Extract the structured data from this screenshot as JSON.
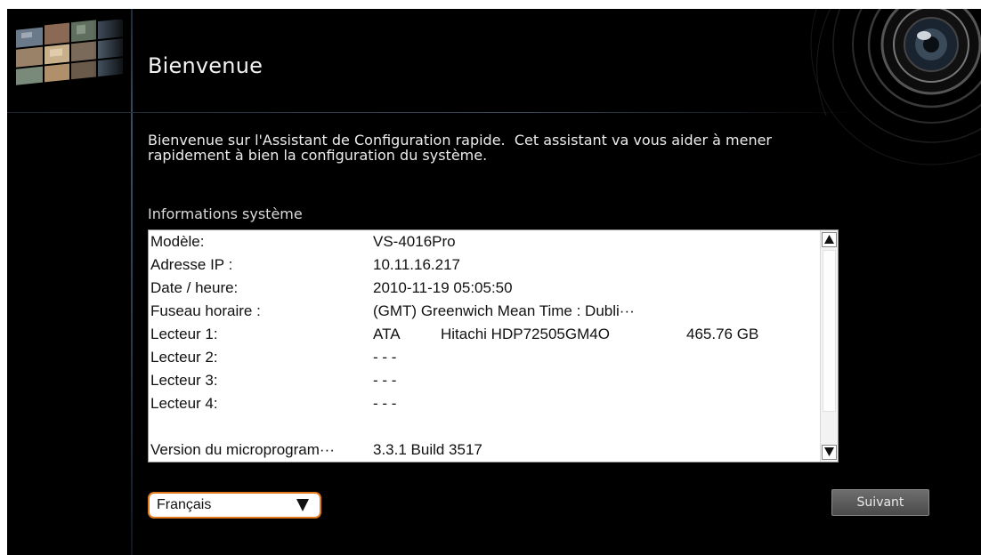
{
  "header": {
    "title": "Bienvenue"
  },
  "welcome": {
    "line1": "Bienvenue sur l'Assistant de Configuration rapide.  Cet assistant va vous aider à mener",
    "line2": "rapidement à bien la configuration du système."
  },
  "system_info": {
    "heading": "Informations système",
    "rows": [
      {
        "label": "Modèle:",
        "value": "VS-4016Pro"
      },
      {
        "label": "Adresse IP :",
        "value": "10.11.16.217"
      },
      {
        "label": "Date / heure:",
        "value": "2010-11-19 05:05:50"
      },
      {
        "label": "Fuseau horaire :",
        "value": "(GMT) Greenwich Mean Time : Dubli···"
      },
      {
        "label": "Lecteur 1:",
        "value": "ATA",
        "model": "Hitachi HDP72505GM4O",
        "size": "465.76 GB"
      },
      {
        "label": "Lecteur 2:",
        "value": "- - -"
      },
      {
        "label": "Lecteur 3:",
        "value": "- - -"
      },
      {
        "label": "Lecteur 4:",
        "value": "- - -"
      },
      {
        "label": "Version du microprogram···",
        "value": "3.3.1 Build 3517"
      }
    ]
  },
  "language": {
    "selected": "Français"
  },
  "footer": {
    "next_label": "Suivant"
  },
  "icons": {
    "scroll_up": "triangle-up-icon",
    "scroll_down": "triangle-down-icon",
    "dropdown": "triangle-down-icon",
    "logo": "camera-mosaic-logo",
    "lens": "camera-lens-icon"
  },
  "colors": {
    "background": "#000000",
    "select_border": "#e07a1c",
    "button": "#5a5a5a"
  }
}
